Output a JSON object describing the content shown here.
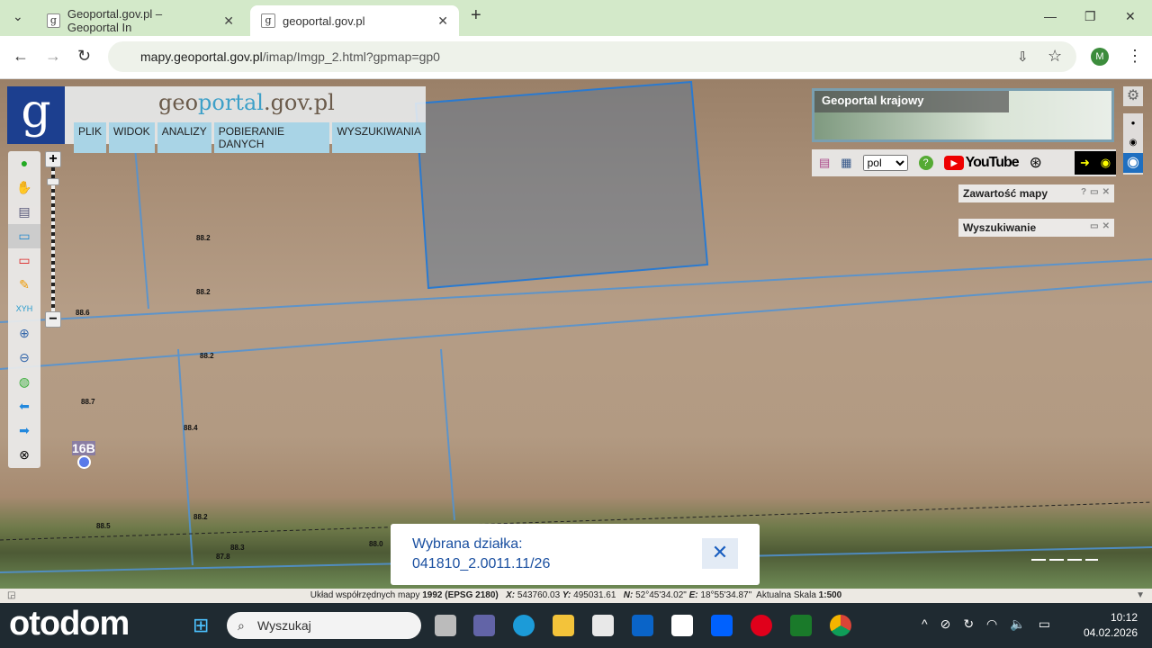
{
  "browser": {
    "tabs": [
      {
        "title": "Geoportal.gov.pl – Geoportal In"
      },
      {
        "title": "geoportal.gov.pl"
      }
    ],
    "url_host": "mapy.geoportal.gov.pl",
    "url_path": "/imap/Imgp_2.html?gpmap=gp0",
    "profile_initial": "M"
  },
  "header": {
    "logo_letter": "g",
    "brand_geo": "geo",
    "brand_portal": "portal",
    "brand_rest": ".gov.pl",
    "menu": [
      "PLIK",
      "WIDOK",
      "ANALIZY",
      "POBIERANIE DANYCH",
      "WYSZUKIWANIA"
    ]
  },
  "overview": {
    "title": "Geoportal krajowy"
  },
  "right_tools": {
    "language": "pol",
    "youtube": "YouTube"
  },
  "panels": {
    "map_contents": "Zawartość mapy",
    "search": "Wyszukiwanie"
  },
  "map": {
    "marker_label": "16B",
    "elevations": [
      "88.2",
      "88.2",
      "88.6",
      "88.2",
      "88.7",
      "88.4",
      "88.2",
      "88.5",
      "88.3",
      "87.8",
      "88.0"
    ]
  },
  "popup": {
    "title": "Wybrana działka:",
    "parcel_id": "041810_2.0011.11/26"
  },
  "status": {
    "label": "Układ współrzędnych mapy",
    "crs": "1992 (EPSG 2180)",
    "x_label": "X:",
    "x": "543760.03",
    "y_label": "Y:",
    "y": "495031.61",
    "n_label": "N:",
    "n": "52°45'34.02\"",
    "e_label": "E:",
    "e": "18°55'34.87\"",
    "scale_label": "Aktualna Skala",
    "scale": "1:500"
  },
  "taskbar": {
    "brand": "otodom",
    "search_placeholder": "Wyszukaj",
    "time": "10:12",
    "date": "04.02.2026"
  }
}
